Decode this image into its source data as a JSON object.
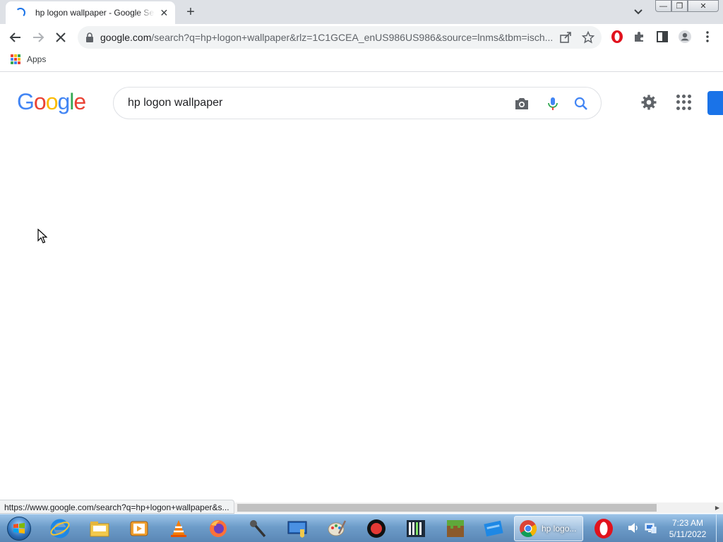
{
  "browser": {
    "tab_title": "hp logon wallpaper - Google Search",
    "tab_close": "✕",
    "new_tab": "+",
    "window_min": "—",
    "window_max": "❐",
    "window_close": "✕",
    "url_host": "google.com",
    "url_rest": "/search?q=hp+logon+wallpaper&rlz=1C1GCEA_enUS986US986&source=lnms&tbm=isch...",
    "bookmarks": {
      "apps_label": "Apps"
    },
    "status_url": "https://www.google.com/search?q=hp+logon+wallpaper&s..."
  },
  "google": {
    "logo_letters": [
      "G",
      "o",
      "o",
      "g",
      "l",
      "e"
    ],
    "logo_colors": [
      "#4285f4",
      "#ea4335",
      "#fbbc05",
      "#4285f4",
      "#34a853",
      "#ea4335"
    ],
    "search_query": "hp logon wallpaper"
  },
  "taskbar": {
    "active_window_label": "hp logo...",
    "clock_time": "7:23 AM",
    "clock_date": "5/11/2022"
  },
  "icons": {
    "toolbar": [
      "back-icon",
      "forward-icon",
      "stop-loading-icon",
      "lock-icon",
      "share-icon",
      "star-icon",
      "opera-extension-icon",
      "puzzle-icon",
      "side-panel-icon",
      "profile-icon",
      "kebab-menu-icon"
    ],
    "search": [
      "camera-icon",
      "microphone-icon",
      "search-icon"
    ],
    "taskbar": [
      "internet-explorer-icon",
      "file-explorer-icon",
      "media-player-icon",
      "vlc-icon",
      "firefox-icon",
      "microphone-app-icon",
      "remote-desktop-icon",
      "paint-icon",
      "record-icon",
      "piano-icon",
      "minecraft-icon",
      "app-window-icon",
      "chrome-icon",
      "opera-icon",
      "volume-icon",
      "network-icon"
    ]
  }
}
